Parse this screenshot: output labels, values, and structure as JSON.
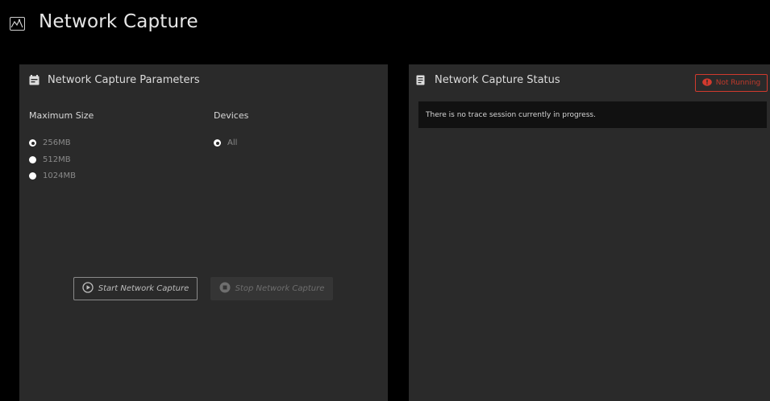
{
  "header": {
    "title": "Network Capture",
    "icon": "chart-image-icon"
  },
  "parameters_panel": {
    "title": "Network Capture Parameters",
    "icon": "form-icon",
    "max_size": {
      "label": "Maximum Size",
      "options": [
        "256MB",
        "512MB",
        "1024MB"
      ],
      "selected": "256MB"
    },
    "devices": {
      "label": "Devices",
      "options": [
        "All"
      ],
      "selected": "All"
    },
    "start_button_label": "Start Network Capture",
    "stop_button_label": "Stop Network Capture"
  },
  "status_panel": {
    "title": "Network Capture Status",
    "icon": "document-icon",
    "badge_label": "Not Running",
    "badge_color": "#d13a2e",
    "message": "There is no trace session currently in progress."
  }
}
